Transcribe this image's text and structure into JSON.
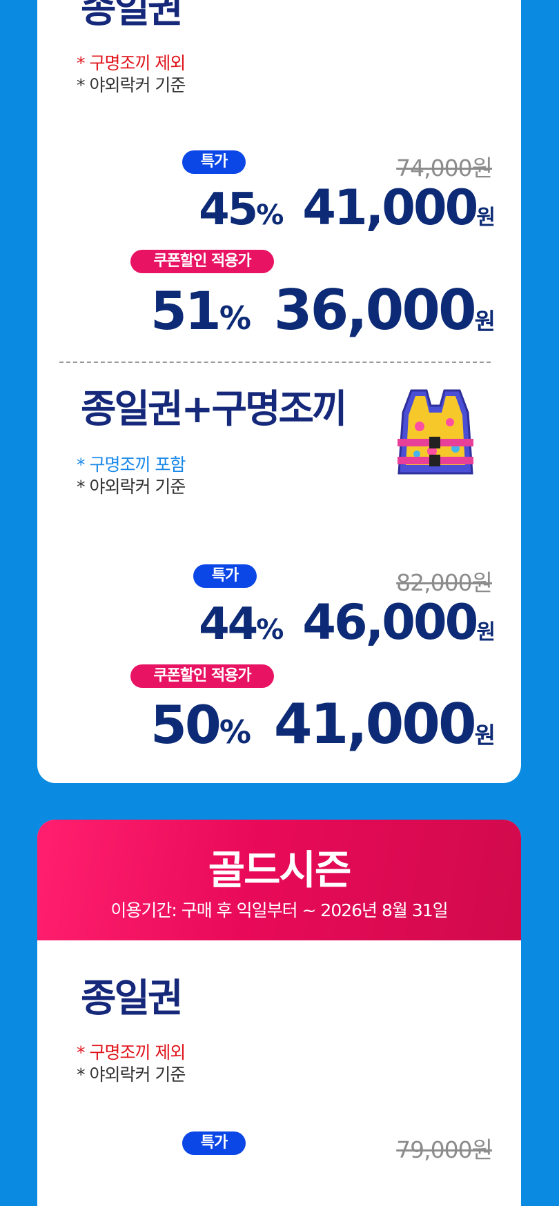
{
  "sections": [
    {
      "products": [
        {
          "title": "종일권",
          "notes": [
            "* 구명조끼 제외",
            "* 야외락커 기준"
          ],
          "special_badge": "특가",
          "original_price": "74,000원",
          "special": {
            "percent": "45",
            "percent_unit": "%",
            "amount": "41,000",
            "currency": "원"
          },
          "coupon_badge": "쿠폰할인 적용가",
          "coupon": {
            "percent": "51",
            "percent_unit": "%",
            "amount": "36,000",
            "currency": "원"
          }
        },
        {
          "title": "종일권+구명조끼",
          "notes": [
            "* 구명조끼 포함",
            "* 야외락커 기준"
          ],
          "image_icon": "life-vest",
          "special_badge": "특가",
          "original_price": "82,000원",
          "special": {
            "percent": "44",
            "percent_unit": "%",
            "amount": "46,000",
            "currency": "원"
          },
          "coupon_badge": "쿠폰할인 적용가",
          "coupon": {
            "percent": "50",
            "percent_unit": "%",
            "amount": "41,000",
            "currency": "원"
          }
        }
      ]
    },
    {
      "title": "골드시즌",
      "period": "이용기간: 구매 후 익일부터 ~ 2026년 8월 31일",
      "products": [
        {
          "title": "종일권",
          "notes": [
            "* 구명조끼 제외",
            "* 야외락커 기준"
          ],
          "special_badge": "특가",
          "original_price": "79,000원"
        }
      ]
    }
  ],
  "colors": {
    "background": "#0a8ae0",
    "price_navy": "#0c2a75",
    "special_badge": "#0b46e6",
    "coupon_badge": "#e81463",
    "gold_header": "#e80a58"
  }
}
